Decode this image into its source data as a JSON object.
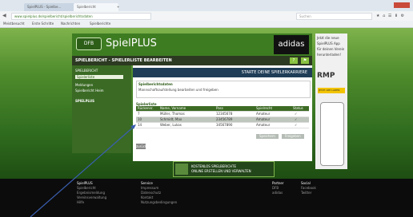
{
  "browser": {
    "tabs": [
      "SpielPLUS - Spielbe...",
      "Spielbericht",
      "+"
    ],
    "url": "www.spielplus.de/spielbericht/spielberichtsdaten",
    "search_placeholder": "Suchen",
    "bookmarks": [
      "Meistbesucht",
      "Erste Schritte",
      "Nachrichten",
      "Spielberichte"
    ]
  },
  "site": {
    "logo": "SpielPLUS",
    "logo_badge": "DFB",
    "sponsor": "adidas",
    "title": "SPIELBERICHT - SPIELERLISTE BEARBEITEN"
  },
  "sidebar": {
    "items": [
      "SPIELBERICHT",
      "Spielerliste",
      "Meldungen",
      "Spielbericht Heim",
      "SPIELPLUS"
    ]
  },
  "banner": "STARTE DEINE SPIELERKARRIERE",
  "info_box": {
    "heading": "Spielberichtsdaten",
    "text": "Mannschaftsaufstellung bearbeiten und freigeben"
  },
  "table": {
    "caption": "Spielerliste",
    "headers": [
      "Rückennr.",
      "Name, Vorname",
      "Pass",
      "Spielrecht",
      "Status"
    ],
    "rows": [
      [
        "7",
        "Müller, Thomas",
        "12345678",
        "Amateur",
        "✓"
      ],
      [
        "10",
        "Schmidt, Max",
        "23456789",
        "Amateur",
        "✓"
      ],
      [
        "14",
        "Weber, Lukas",
        "34567890",
        "Amateur",
        "✓"
      ]
    ]
  },
  "buttons": [
    "Speichern",
    "Freigeben"
  ],
  "back_label": "zurück",
  "bottom_ad": [
    "KOSTENLOS SPIELBERICHTE",
    "ONLINE ERSTELLEN UND VERWALTEN"
  ],
  "right_ad": {
    "lines": [
      "Jetzt die neue",
      "SpielPLUS App",
      "für deinen Verein",
      "herunterladen!"
    ],
    "rmp": "RMP",
    "promo": "JETZT APP LADEN"
  },
  "footer": {
    "col1": {
      "title": "SpielPLUS",
      "lines": [
        "Spielbericht",
        "Ergebnismeldung",
        "Vereinsverwaltung",
        "Hilfe"
      ]
    },
    "col2": {
      "title": "Service",
      "lines": [
        "Impressum",
        "Datenschutz",
        "Kontakt",
        "Nutzungsbedingungen"
      ]
    },
    "col3": {
      "title": "Partner",
      "lines": [
        "DFB",
        "adidas"
      ]
    },
    "col4": {
      "title": "Social",
      "lines": [
        "Facebook",
        "Twitter"
      ]
    }
  },
  "colors": {
    "brand_green": "#3e7c22",
    "dark": "#2d3a22",
    "annotation_arrow": "#3a5fb0"
  }
}
